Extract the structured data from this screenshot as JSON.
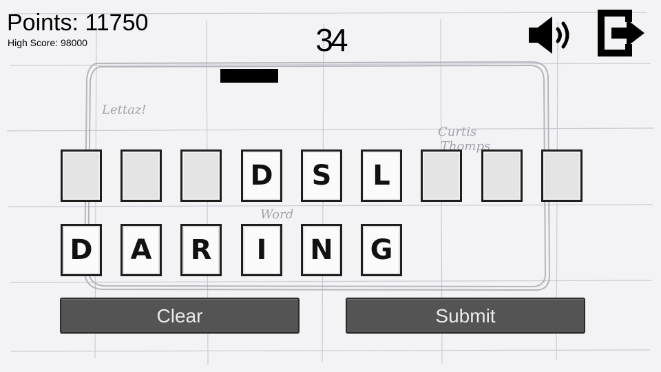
{
  "hud": {
    "points_text": "Points: 11750",
    "high_score_text": "High Score: 98000",
    "timer_value": "34",
    "timer_remaining_fraction": 0.45
  },
  "icons": {
    "sound": "speaker-volume-icon",
    "exit": "exit-door-icon"
  },
  "slots": [
    {
      "letter": ""
    },
    {
      "letter": ""
    },
    {
      "letter": ""
    },
    {
      "letter": "D"
    },
    {
      "letter": "S"
    },
    {
      "letter": "L"
    },
    {
      "letter": ""
    },
    {
      "letter": ""
    },
    {
      "letter": ""
    }
  ],
  "tiles": [
    {
      "letter": "D"
    },
    {
      "letter": "A"
    },
    {
      "letter": "R"
    },
    {
      "letter": "I"
    },
    {
      "letter": "N"
    },
    {
      "letter": "G"
    }
  ],
  "buttons": {
    "clear_label": "Clear",
    "submit_label": "Submit"
  },
  "colors": {
    "button_bg": "#545454",
    "button_text": "#ececec",
    "paper_bg": "#f3f3f6"
  }
}
